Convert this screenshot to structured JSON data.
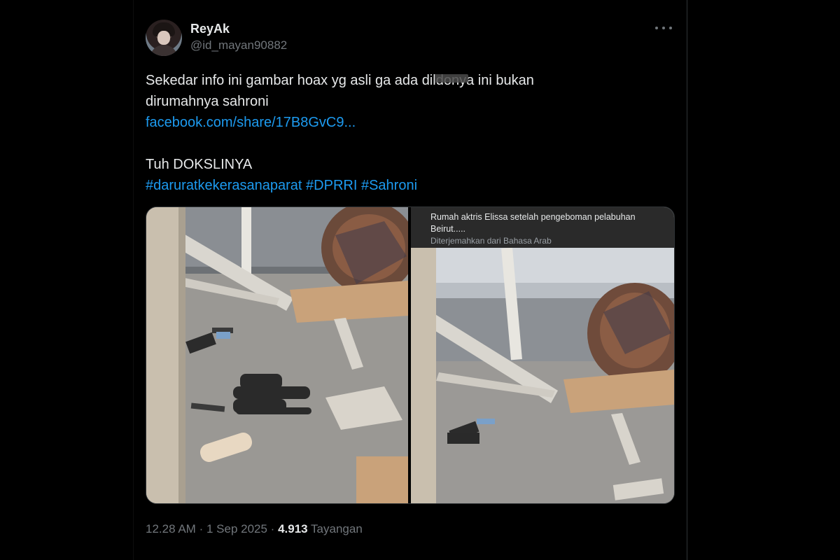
{
  "tweet": {
    "display_name": "ReyAk",
    "handle": "@id_mayan90882",
    "text_line1_a": "Sekedar info ini gambar hoax yg asli ga ada ",
    "text_line1_redacted": "dildonya",
    "text_line1_b": " ini bukan",
    "text_line2": "dirumahnya sahroni",
    "link": "facebook.com/share/17B8GvC9...",
    "line4": "Tuh DOKSLINYA",
    "hashtags": [
      "#daruratkekerasanaparat",
      "#DPRRI",
      "#Sahroni"
    ],
    "media": {
      "right_caption": "Rumah aktris Elissa setelah pengeboman pelabuhan Beirut.....",
      "right_translation": "Diterjemahkan dari Bahasa Arab"
    },
    "time": "12.28 AM",
    "separator": "·",
    "date": "1 Sep 2025",
    "views_count": "4.913",
    "views_label": "Tayangan"
  },
  "icons": {
    "more": "more-horizontal-icon"
  },
  "colors": {
    "background": "#000000",
    "text": "#e7e9ea",
    "muted": "#71767b",
    "link": "#1d9bf0"
  }
}
